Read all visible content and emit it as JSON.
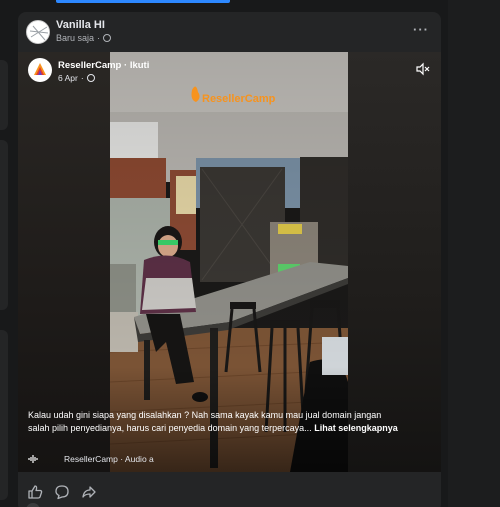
{
  "post": {
    "author": "Vanilla HI",
    "time": "Baru saja",
    "more_icon": "more-horizontal-icon"
  },
  "embed": {
    "page_name": "ResellerCamp",
    "separator": " · ",
    "follow_label": "Ikuti",
    "date": "6 Apr",
    "watermark": "ResellerCamp",
    "caption": "Kalau udah gini siapa yang disalahkan ? Nah sama kayak kamu mau jual domain jangan salah pilih penyedianya, harus cari penyedia domain yang terpercaya...",
    "see_more": "Lihat selengkapnya",
    "audio_label": "ResellerCamp · Audio a"
  },
  "colors": {
    "background": "#18191a",
    "card": "#242526",
    "accent": "#2d88ff",
    "text_primary": "#e4e6eb",
    "text_secondary": "#b0b3b8",
    "brand_orange": "#f7931e",
    "brand_red": "#e23a2b"
  }
}
